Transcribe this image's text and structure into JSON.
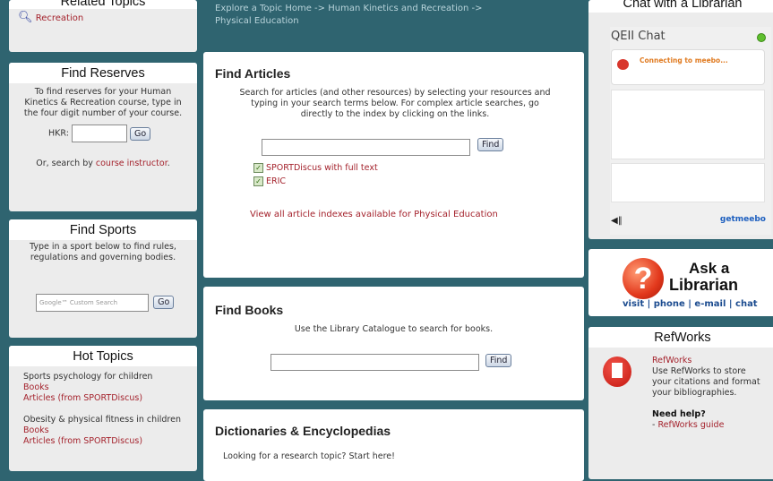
{
  "related": {
    "title": "Related Topics",
    "link": "Recreation"
  },
  "reserves": {
    "title": "Find Reserves",
    "desc": "To find reserves for your Human Kinetics & Recreation course, type in the four digit number of your course.",
    "prefix": "HKR",
    "go": "Go",
    "or_text": "Or, search by ",
    "instructor": "course instructor",
    "period": "."
  },
  "sports": {
    "title": "Find Sports",
    "desc": "Type in a sport below to find rules, regulations and governing bodies.",
    "placeholder": "Google™ Custom Search",
    "go": "Go"
  },
  "hot": {
    "title": "Hot Topics",
    "t1": "Sports psychology for children",
    "t1_books": "Books",
    "t1_articles": "Articles (from SPORTDiscus)",
    "t2": "Obesity & physical fitness in children",
    "t2_books": "Books",
    "t2_articles": "Articles (from SPORTDiscus)"
  },
  "header": {
    "breadcrumb1": "Explore a Topic Home -> Human Kinetics and Recreation ->",
    "breadcrumb2": "Physical Education"
  },
  "articles": {
    "title": "Find Articles",
    "desc": "Search for articles (and other resources) by selecting your resources and typing in your search terms below. For complex article searches, go directly to the index by clicking on the links.",
    "find": "Find",
    "db1": "SPORTDiscus with full text",
    "db2": "ERIC",
    "viewall": "View all article indexes available for Physical Education"
  },
  "books": {
    "title": "Find Books",
    "desc": "Use the Library Catalogue to search for books.",
    "find": "Find"
  },
  "dict": {
    "title": "Dictionaries & Encyclopedias",
    "desc": "Looking for a research topic? Start here!"
  },
  "chat": {
    "title": "Chat with a Librarian",
    "widget": "QEII Chat",
    "status": "Connecting to meebo...",
    "brand_get": "get",
    "brand_meebo": "meebo"
  },
  "ask": {
    "line1": "Ask a",
    "line2": "Librarian",
    "visit": "visit",
    "phone": "phone",
    "email": "e-mail",
    "chat": "chat",
    "sep": "|"
  },
  "refworks": {
    "title": "RefWorks",
    "link": "RefWorks",
    "desc": "Use RefWorks to store your citations and format your bibliographies.",
    "help": "Need help?",
    "guide_prefix": "- ",
    "guide": "RefWorks guide"
  }
}
